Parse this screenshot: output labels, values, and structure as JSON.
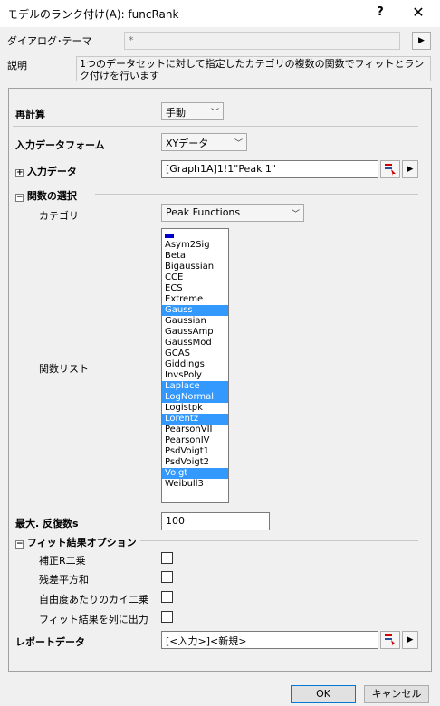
{
  "window": {
    "title": "モデルのランク付け(A): funcRank",
    "help": "?",
    "close": "✕"
  },
  "theme": {
    "label": "ダイアログ･テーマ",
    "value": "*"
  },
  "description": {
    "label": "説明",
    "text": "1つのデータセットに対して指定したカテゴリの複数の関数でフィットとランク付けを行います"
  },
  "recalc": {
    "label": "再計算",
    "value": "手動"
  },
  "input_form": {
    "label": "入力データフォーム",
    "value": "XYデータ"
  },
  "input_data": {
    "label": "入力データ",
    "value": "[Graph1A]1!1\"Peak 1\""
  },
  "function_select": {
    "label": "関数の選択",
    "category_label": "カテゴリ",
    "category_value": "Peak Functions",
    "list_label": "関数リスト",
    "items": [
      {
        "label": "",
        "selected": false
      },
      {
        "label": "Asym2Sig",
        "selected": false
      },
      {
        "label": "Beta",
        "selected": false
      },
      {
        "label": "Bigaussian",
        "selected": false
      },
      {
        "label": "CCE",
        "selected": false
      },
      {
        "label": "ECS",
        "selected": false
      },
      {
        "label": "Extreme",
        "selected": false
      },
      {
        "label": "Gauss",
        "selected": true
      },
      {
        "label": "Gaussian",
        "selected": false
      },
      {
        "label": "GaussAmp",
        "selected": false
      },
      {
        "label": "GaussMod",
        "selected": false
      },
      {
        "label": "GCAS",
        "selected": false
      },
      {
        "label": "Giddings",
        "selected": false
      },
      {
        "label": "InvsPoly",
        "selected": false
      },
      {
        "label": "Laplace",
        "selected": true
      },
      {
        "label": "LogNormal",
        "selected": true
      },
      {
        "label": "Logistpk",
        "selected": false
      },
      {
        "label": "Lorentz",
        "selected": true
      },
      {
        "label": "PearsonVII",
        "selected": false
      },
      {
        "label": "PearsonIV",
        "selected": false
      },
      {
        "label": "PsdVoigt1",
        "selected": false
      },
      {
        "label": "PsdVoigt2",
        "selected": false
      },
      {
        "label": "Voigt",
        "selected": true
      },
      {
        "label": "Weibull3",
        "selected": false
      }
    ]
  },
  "max_iter": {
    "label": "最大. 反復数s",
    "value": "100"
  },
  "fit_options": {
    "label": "フィット結果オプション",
    "items": [
      {
        "label": "補正R二乗",
        "checked": false
      },
      {
        "label": "残差平方和",
        "checked": false
      },
      {
        "label": "自由度あたりのカイ二乗",
        "checked": false
      },
      {
        "label": "フィット結果を列に出力",
        "checked": false
      }
    ]
  },
  "report": {
    "label": "レポートデータ",
    "value": "[<入力>]<新規>"
  },
  "buttons": {
    "ok": "OK",
    "cancel": "キャンセル"
  },
  "colors": {
    "selection": "#3399ff",
    "accent_icon": "#cc0000"
  }
}
